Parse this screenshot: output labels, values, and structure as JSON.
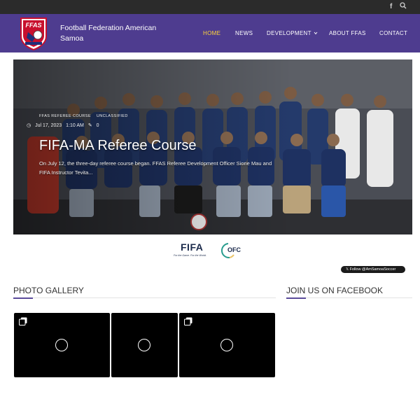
{
  "topbar": {
    "facebook_icon": "f",
    "search_icon": "🔍"
  },
  "header": {
    "site_title": "Football Federation American Samoa",
    "logo_text": "FFAS",
    "nav": [
      {
        "label": "HOME",
        "active": true
      },
      {
        "label": "NEWS",
        "active": false
      },
      {
        "label": "DEVELOPMENT",
        "active": false
      },
      {
        "label": "ABOUT FFAS",
        "active": false
      },
      {
        "label": "CONTACT",
        "active": false
      }
    ],
    "dropdown_caret": "⌄"
  },
  "hero": {
    "categories": [
      "FFAS REFEREE COURSE",
      "UNCLASSIFIED"
    ],
    "date": "Jul 17, 2023",
    "time": "1:10 AM",
    "comments": "0",
    "title": "FIFA-MA Referee Course",
    "excerpt": "On July 12, the three-day referee course began. FFAS Referee Development Officer Sione Mau and FIFA Instructor Tevita..."
  },
  "sponsors": {
    "fifa_word": "FIFA",
    "fifa_tagline": "For the Game. For the World.",
    "ofc_word": "OFC"
  },
  "twitter": {
    "follow_label": "Follow @AmSamoaSoccer"
  },
  "sections": {
    "gallery_title": "PHOTO GALLERY",
    "facebook_title": "JOIN US ON FACEBOOK"
  },
  "colors": {
    "header": "#4e3c8f",
    "topbar": "#2b2b2b",
    "nav_active": "#ffd43b",
    "accent": "#5a4a9a"
  }
}
